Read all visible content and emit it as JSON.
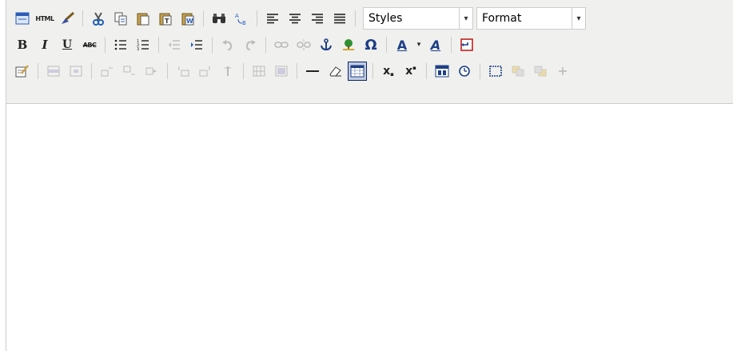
{
  "toolbar": {
    "styles_select": {
      "value": "Styles"
    },
    "format_select": {
      "value": "Format"
    },
    "glyphs": {
      "html": "HTML",
      "bold": "B",
      "italic": "I",
      "underline": "U",
      "strike": "ABC",
      "omega": "Ω",
      "forecolor": "A",
      "backcolor": "A",
      "dropdown_arrow": "▾",
      "sub": "x",
      "sup": "x"
    },
    "colors": {
      "forecolor_bar": "#808080",
      "backcolor_bar": "#808080",
      "accent": "#0a246a"
    }
  }
}
